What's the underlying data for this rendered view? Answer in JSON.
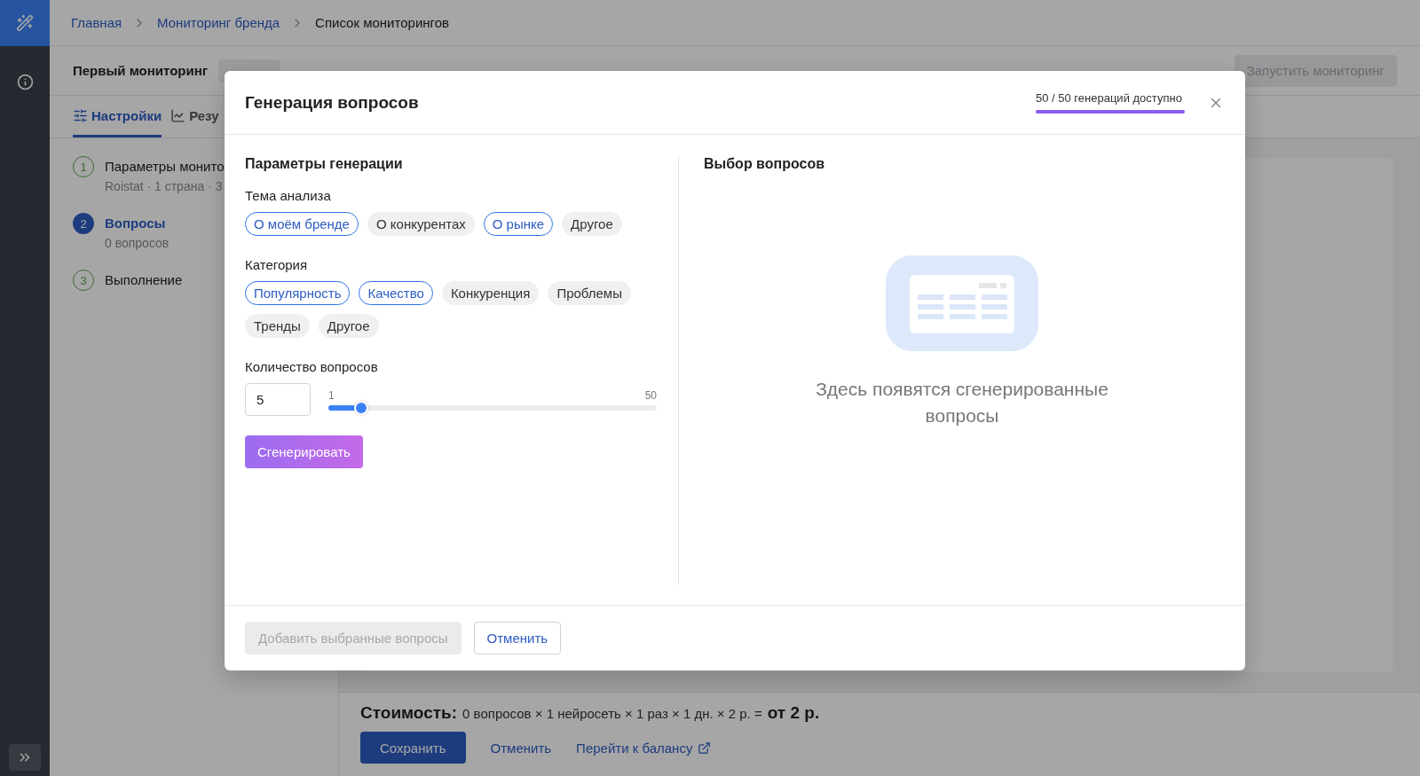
{
  "sidebar": {
    "nav": [
      {
        "kind": "magic",
        "selected": true
      },
      {
        "kind": "info",
        "selected": false
      }
    ]
  },
  "breadcrumbs": [
    "Главная",
    "Мониторинг бренда",
    "Список мониторингов"
  ],
  "monitor": {
    "title": "Первый мониторинг",
    "run_button": {
      "label": "Запустить мониторинг",
      "disabled": true
    }
  },
  "tabs": [
    {
      "label": "Настройки",
      "kind": "settings",
      "selected": true
    },
    {
      "label": "Резу",
      "kind": "results",
      "selected": false
    }
  ],
  "steps": [
    {
      "number": "1",
      "title": "Параметры монито",
      "subtitle": "Roistat · 1 страна · 3",
      "selected": false
    },
    {
      "number": "2",
      "title": "Вопросы",
      "subtitle": "0 вопросов",
      "selected": true
    },
    {
      "number": "3",
      "title": "Выполнение",
      "selected": false
    }
  ],
  "cost": {
    "label": "Стоимость:",
    "formula": "0 вопросов × 1 нейросеть × 1 раз × 1 дн. × 2 р. =",
    "total": "от 2 р."
  },
  "footer_actions": [
    {
      "label": "Сохранить",
      "kind": "primary"
    },
    {
      "label": "Отменить",
      "kind": "link"
    },
    {
      "label": "Перейти к балансу",
      "kind": "external"
    }
  ],
  "modal": {
    "title": "Генерация вопросов",
    "quota": {
      "label": "50 / 50 генераций доступно",
      "level": 1
    },
    "params": {
      "heading": "Параметры генерации",
      "groups": [
        {
          "label": "Тема анализа",
          "chips": [
            {
              "label": "О моём бренде",
              "selected": true
            },
            {
              "label": "О конкурентах",
              "selected": false
            },
            {
              "label": "О рынке",
              "selected": true
            },
            {
              "label": "Другое",
              "selected": false
            }
          ]
        },
        {
          "label": "Категория",
          "chips": [
            {
              "label": "Популярность",
              "selected": true
            },
            {
              "label": "Качество",
              "selected": true
            },
            {
              "label": "Конкуренция",
              "selected": false
            },
            {
              "label": "Проблемы",
              "selected": false
            },
            {
              "label": "Тренды",
              "selected": false
            },
            {
              "label": "Другое",
              "selected": false
            }
          ]
        }
      ],
      "count": {
        "label": "Количество вопросов",
        "value": "5",
        "min": "1",
        "max": "50",
        "level": 0.1
      },
      "generate_button": "Сгенерировать"
    },
    "selection": {
      "heading": "Выбор вопросов",
      "empty_text": "Здесь появятся сгенерированные вопросы"
    },
    "buttons": [
      {
        "label": "Добавить выбранные вопросы",
        "disabled": true
      },
      {
        "label": "Отменить",
        "disabled": false
      }
    ]
  }
}
